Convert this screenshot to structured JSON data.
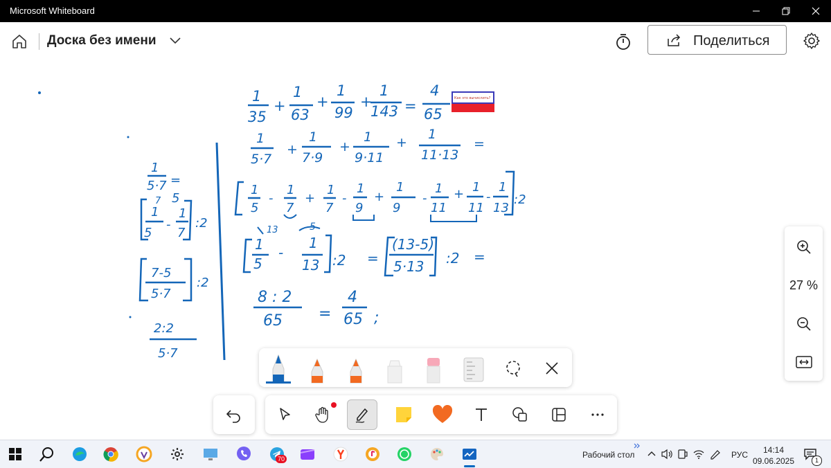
{
  "window": {
    "title": "Microsoft Whiteboard"
  },
  "appbar": {
    "board_title": "Доска без имени",
    "share_label": "Поделиться"
  },
  "zoom": {
    "value": "27 %"
  },
  "taskbar": {
    "desktop_label": "Рабочий стол",
    "lang": "РУС",
    "time": "14:14",
    "date": "09.06.2025",
    "telegram_badge": "70",
    "notif_count": "1"
  },
  "colors": {
    "ink": "#1466b8",
    "accent_orange": "#f26a21",
    "titlebar": "#000000",
    "taskbar": "#f0f3f9"
  },
  "note_thumbnail": {
    "text": "Как это вычислить?"
  },
  "ink": {
    "l1": [
      "1",
      "35",
      "+",
      "1",
      "63",
      "+",
      "1",
      "99",
      "+",
      "1",
      "143",
      "=",
      "4",
      "65"
    ],
    "l2": [
      "1",
      "5·7",
      "+",
      "1",
      "7·9",
      "+",
      "1",
      "9·11",
      "+",
      "1",
      "11·13",
      "="
    ],
    "l3": [
      "1",
      "5",
      "-",
      "1",
      "7",
      "+",
      "1",
      "7",
      "-",
      "1",
      "9",
      "+",
      "1",
      "9",
      "-",
      "1",
      "11",
      "+",
      "1",
      "11",
      "-",
      "1",
      "13",
      ":2"
    ],
    "l4": [
      "13",
      "5",
      "1",
      "5",
      "-",
      "1",
      "13",
      ":2",
      "=",
      "(13-5)",
      "5·13",
      ":2",
      "="
    ],
    "l5": [
      "8 : 2",
      "65",
      "=",
      "4",
      "65",
      ";"
    ],
    "left": [
      "1",
      "5·7",
      "=",
      "5",
      "7",
      "1",
      "5",
      "-",
      "1",
      "7",
      ":2",
      "7-5",
      "5·7",
      ":2",
      "2:2",
      "5·7"
    ]
  }
}
